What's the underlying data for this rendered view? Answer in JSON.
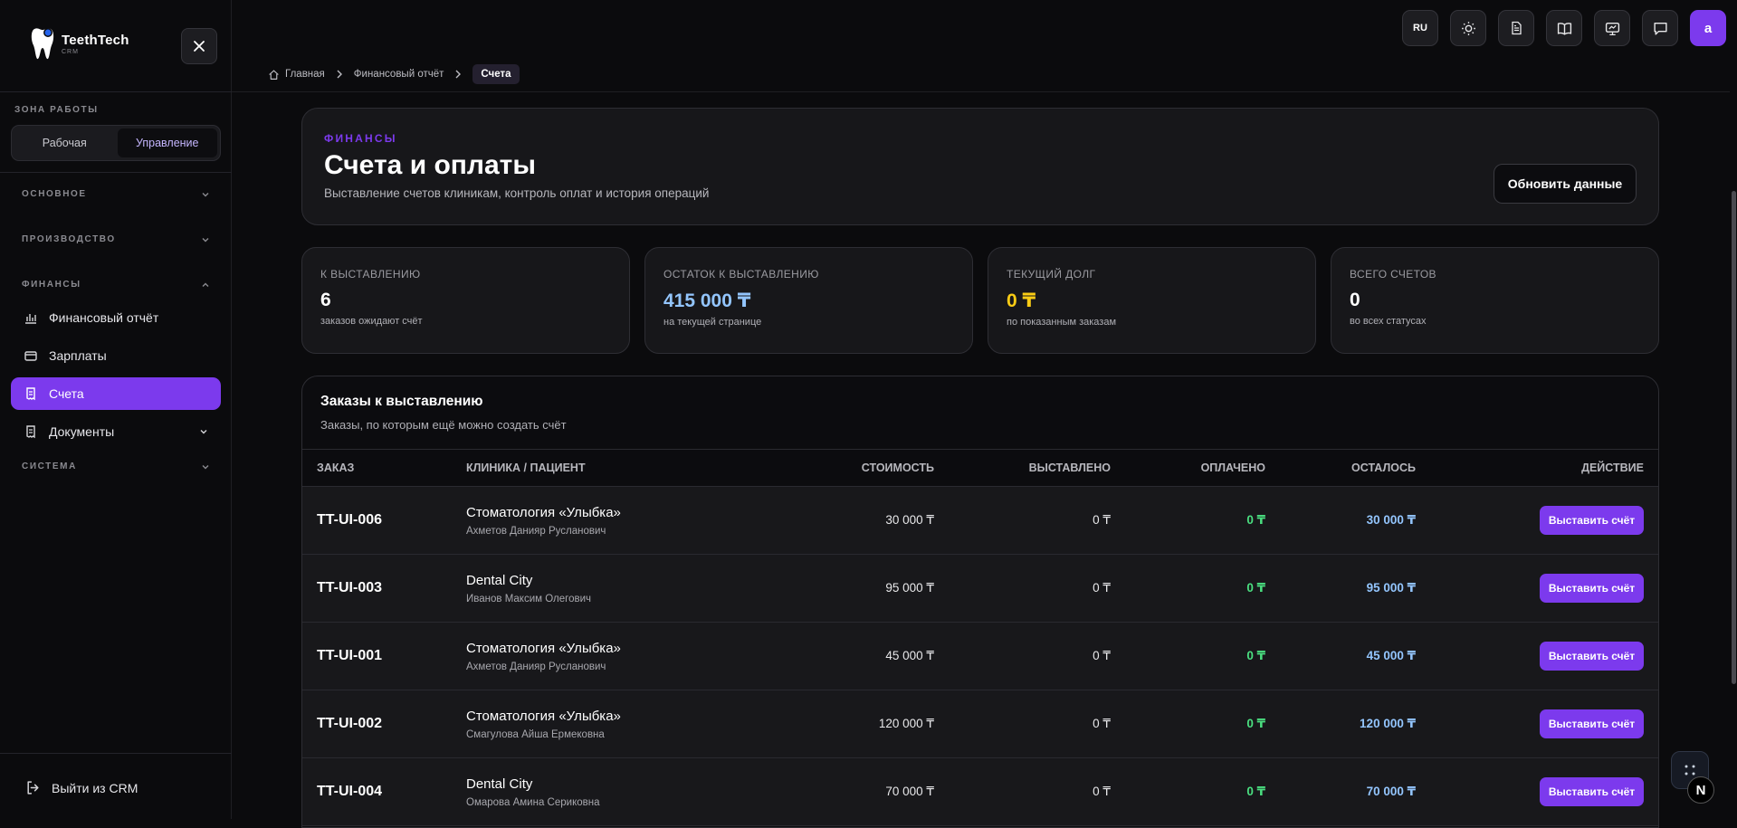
{
  "brand": {
    "name": "TeethTech",
    "sub": "CRM"
  },
  "sidebar": {
    "zone_label": "ЗОНА РАБОТЫ",
    "zone_options": [
      "Рабочая",
      "Управление"
    ],
    "groups": {
      "main": "ОСНОВНОЕ",
      "production": "ПРОИЗВОДСТВО",
      "finance": "ФИНАНСЫ",
      "system": "СИСТЕМА"
    },
    "items": {
      "fin_report": "Финансовый отчёт",
      "salaries": "Зарплаты",
      "invoices": "Счета",
      "documents": "Документы"
    },
    "logout": "Выйти из CRM"
  },
  "breadcrumb": [
    "Главная",
    "Финансовый отчёт",
    "Счета"
  ],
  "topbar": {
    "lang": "RU",
    "avatar": "a"
  },
  "hero": {
    "eyebrow": "ФИНАНСЫ",
    "title": "Счета и оплаты",
    "subtitle": "Выставление счетов клиникам, контроль оплат и история операций",
    "refresh": "Обновить данные"
  },
  "stats": [
    {
      "label": "К выставлению",
      "value": "6",
      "note": "заказов ожидают счёт"
    },
    {
      "label": "Остаток к выставлению",
      "value": "415 000 ₸",
      "note": "на текущей странице"
    },
    {
      "label": "Текущий долг",
      "value": "0 ₸",
      "note": "по показанным заказам"
    },
    {
      "label": "Всего счетов",
      "value": "0",
      "note": "во всех статусах"
    }
  ],
  "panel": {
    "title": "Заказы к выставлению",
    "subtitle": "Заказы, по которым ещё можно создать счёт",
    "columns": [
      "ЗАКАЗ",
      "КЛИНИКА / ПАЦИЕНТ",
      "СТОИМОСТЬ",
      "ВЫСТАВЛЕНО",
      "ОПЛАЧЕНО",
      "ОСТАЛОСЬ",
      "ДЕЙСТВИЕ"
    ],
    "action_label": "Выставить счёт",
    "rows": [
      {
        "order": "TT-UI-006",
        "clinic": "Стоматология «Улыбка»",
        "patient": "Ахметов Данияр Русланович",
        "cost": "30 000 ₸",
        "billed": "0 ₸",
        "paid": "0 ₸",
        "left": "30 000 ₸"
      },
      {
        "order": "TT-UI-003",
        "clinic": "Dental City",
        "patient": "Иванов Максим Олегович",
        "cost": "95 000 ₸",
        "billed": "0 ₸",
        "paid": "0 ₸",
        "left": "95 000 ₸"
      },
      {
        "order": "TT-UI-001",
        "clinic": "Стоматология «Улыбка»",
        "patient": "Ахметов Данияр Русланович",
        "cost": "45 000 ₸",
        "billed": "0 ₸",
        "paid": "0 ₸",
        "left": "45 000 ₸"
      },
      {
        "order": "TT-UI-002",
        "clinic": "Стоматология «Улыбка»",
        "patient": "Смагулова Айша Ермековна",
        "cost": "120 000 ₸",
        "billed": "0 ₸",
        "paid": "0 ₸",
        "left": "120 000 ₸"
      },
      {
        "order": "TT-UI-004",
        "clinic": "Dental City",
        "patient": "Омарова Амина Сериковна",
        "cost": "70 000 ₸",
        "billed": "0 ₸",
        "paid": "0 ₸",
        "left": "70 000 ₸"
      }
    ]
  },
  "fab_badge": "N",
  "colors": {
    "accent": "#7c3aed",
    "paid": "#4ade80",
    "remaining": "#93c5fd",
    "debt": "#facc15"
  }
}
